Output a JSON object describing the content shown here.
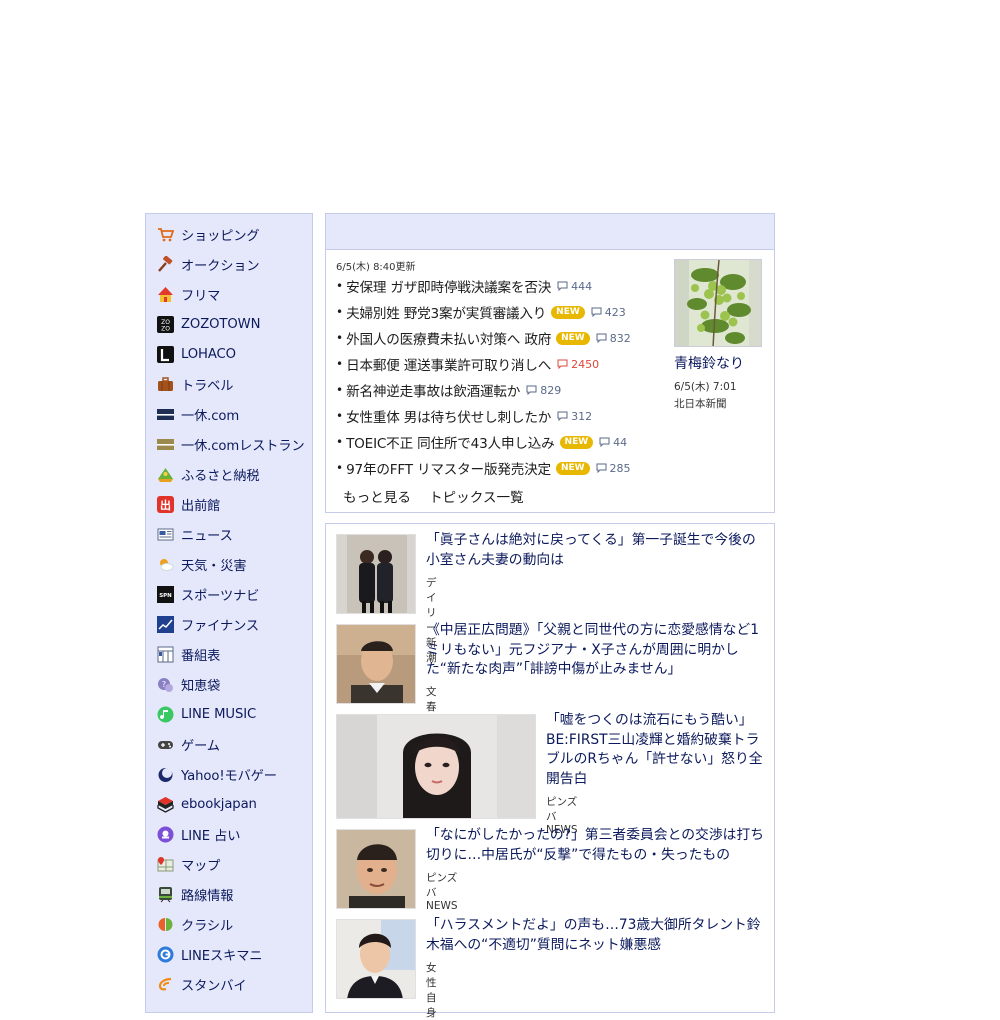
{
  "sidebar": {
    "items": [
      {
        "label": "ショッピング",
        "icon": "shopping-cart-icon"
      },
      {
        "label": "オークション",
        "icon": "auction-hammer-icon"
      },
      {
        "label": "フリマ",
        "icon": "flea-market-tent-icon"
      },
      {
        "label": "ZOZOTOWN",
        "icon": "zozotown-icon"
      },
      {
        "label": "LOHACO",
        "icon": "lohaco-icon"
      },
      {
        "label": "トラベル",
        "icon": "suitcase-icon"
      },
      {
        "label": "一休.com",
        "icon": "ikyu-icon"
      },
      {
        "label": "一休.comレストラン",
        "icon": "ikyu-restaurant-icon"
      },
      {
        "label": "ふるさと納税",
        "icon": "furusato-icon"
      },
      {
        "label": "出前館",
        "icon": "demaekan-icon"
      },
      {
        "label": "ニュース",
        "icon": "news-icon"
      },
      {
        "label": "天気・災害",
        "icon": "weather-icon"
      },
      {
        "label": "スポーツナビ",
        "icon": "sportsnavi-icon"
      },
      {
        "label": "ファイナンス",
        "icon": "finance-chart-icon"
      },
      {
        "label": "番組表",
        "icon": "tv-guide-icon"
      },
      {
        "label": "知恵袋",
        "icon": "chiebukuro-icon"
      },
      {
        "label": "LINE MUSIC",
        "icon": "line-music-icon"
      },
      {
        "label": "ゲーム",
        "icon": "gamepad-icon"
      },
      {
        "label": "Yahoo!モバゲー",
        "icon": "mobage-icon"
      },
      {
        "label": "ebookjapan",
        "icon": "ebook-icon"
      },
      {
        "label": "LINE 占い",
        "icon": "line-fortune-icon"
      },
      {
        "label": "マップ",
        "icon": "map-icon"
      },
      {
        "label": "路線情報",
        "icon": "train-icon"
      },
      {
        "label": "クラシル",
        "icon": "kurashiru-icon"
      },
      {
        "label": "LINEスキマニ",
        "icon": "line-skimani-icon"
      },
      {
        "label": "スタンバイ",
        "icon": "standby-icon"
      }
    ]
  },
  "topics": {
    "updated": "6/5(木) 8:40更新",
    "items": [
      {
        "title": "安保理 ガザ即時停戦決議案を否決",
        "new": false,
        "comments": "444",
        "hot": false
      },
      {
        "title": "夫婦別姓 野党3案が実質審議入り",
        "new": true,
        "comments": "423",
        "hot": false
      },
      {
        "title": "外国人の医療費未払い対策へ 政府",
        "new": true,
        "comments": "832",
        "hot": false
      },
      {
        "title": "日本郵便 運送事業許可取り消しへ",
        "new": false,
        "comments": "2450",
        "hot": true
      },
      {
        "title": "新名神逆走事故は飲酒運転か",
        "new": false,
        "comments": "829",
        "hot": false
      },
      {
        "title": "女性重体 男は待ち伏せし刺したか",
        "new": false,
        "comments": "312",
        "hot": false
      },
      {
        "title": "TOEIC不正 同住所で43人申し込み",
        "new": true,
        "comments": "44",
        "hot": false
      },
      {
        "title": "97年のFFT リマスター版発売決定",
        "new": true,
        "comments": "285",
        "hot": false
      }
    ],
    "new_label": "NEW",
    "more_label": "もっと見る",
    "list_label": "トピックス一覧",
    "photo": {
      "caption": "青梅鈴なり",
      "date": "6/5(木) 7:01",
      "source": "北日本新聞"
    }
  },
  "articles": [
    {
      "title": "「眞子さんは絶対に戻ってくる」第一子誕生で今後の小室さん夫妻の動向は",
      "source": "デイリー新潮"
    },
    {
      "title": "《中居正広問題》「父親と同世代の方に恋愛感情など1ミリもない」元フジアナ・X子さんが周囲に明かした“新たな肉声”「誹謗中傷が止みません」",
      "source": "文春オンライン"
    },
    {
      "title": "「嘘をつくのは流石にもう酷い」BE:FIRST三山凌輝と婚約破棄トラブルのRちゃん「許せない」怒り全開告白",
      "source": "ピンズバNEWS"
    },
    {
      "title": "「なにがしたかったの?」第三者委員会との交渉は打ち切りに…中居氏が“反撃”で得たもの・失ったもの",
      "source": "ピンズバNEWS"
    },
    {
      "title": "「ハラスメントだよ」の声も…73歳大御所タレント鈴木福への“不適切”質問にネット嫌悪感",
      "source": "女性自身"
    }
  ],
  "colors": {
    "accent": "#0c1a5c",
    "panel_bg": "#e5e8fb",
    "new_badge": "#e8b800",
    "hot_comment": "#e0483c"
  }
}
